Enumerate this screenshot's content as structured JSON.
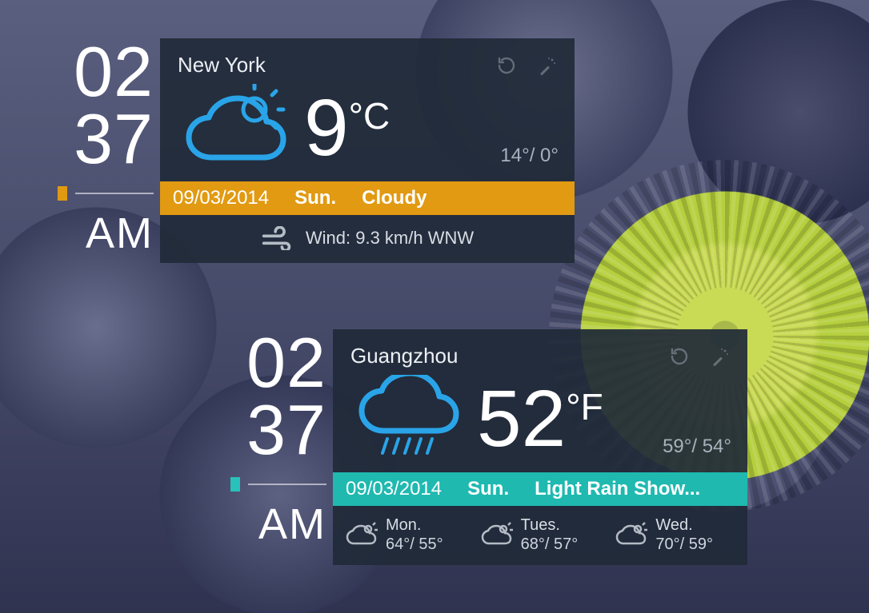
{
  "time": {
    "hh": "02",
    "mm": "37",
    "ampm": "AM"
  },
  "widgets": [
    {
      "city": "New York",
      "accent": "#e19a12",
      "icon": "partly-cloudy",
      "temp": "9",
      "unit": "°C",
      "hi": "14°",
      "lo": "0°",
      "date": "09/03/2014",
      "day": "Sun.",
      "condition": "Cloudy",
      "wind": "Wind: 9.3 km/h WNW"
    },
    {
      "city": "Guangzhou",
      "accent": "#1fb9b0",
      "icon": "rain",
      "temp": "52",
      "unit": "°F",
      "hi": "59°",
      "lo": "54°",
      "date": "09/03/2014",
      "day": "Sun.",
      "condition": "Light Rain Show...",
      "forecast": [
        {
          "day": "Mon.",
          "hl": "64°/ 55°"
        },
        {
          "day": "Tues.",
          "hl": "68°/ 57°"
        },
        {
          "day": "Wed.",
          "hl": "70°/ 59°"
        }
      ]
    }
  ]
}
